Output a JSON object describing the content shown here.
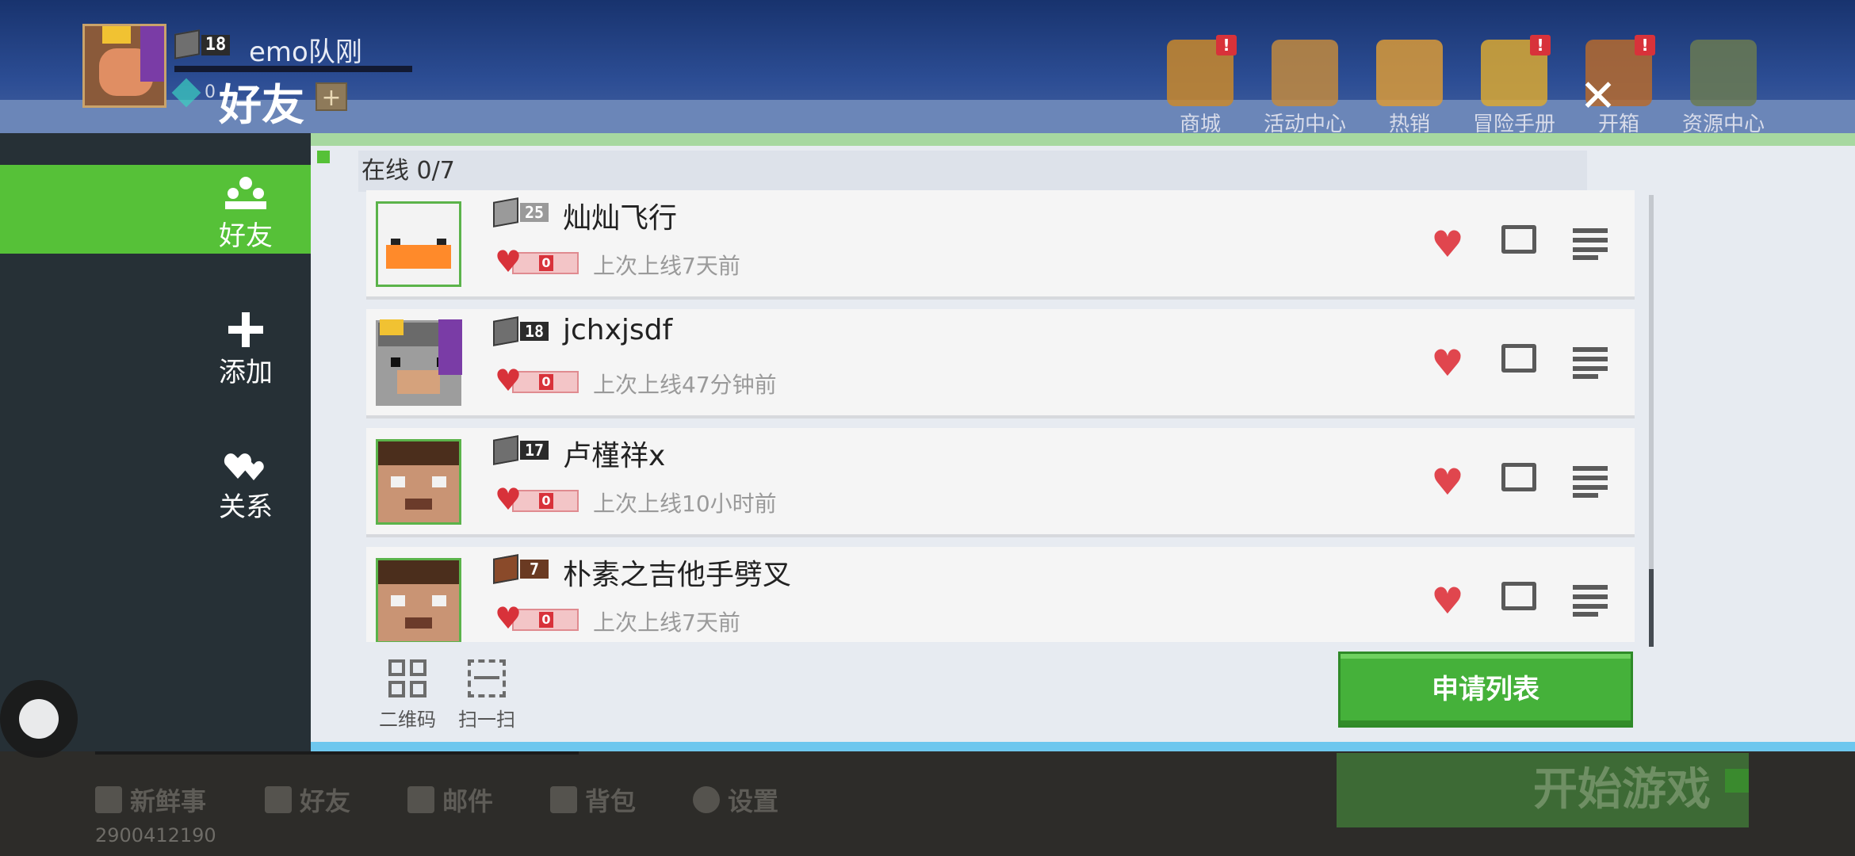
{
  "header": {
    "username": "emo队刚",
    "level": "18",
    "gem_value": "0",
    "page_title": "好友",
    "top_icons": [
      {
        "label": "商城",
        "icon": "shop-icon",
        "alert": "!",
        "color": "#c9882c"
      },
      {
        "label": "活动中心",
        "icon": "activity-center-icon",
        "alert": "",
        "color": "#c28a3e"
      },
      {
        "label": "热销",
        "icon": "hot-sale-icon",
        "alert": "",
        "color": "#d99a38"
      },
      {
        "label": "冒险手册",
        "icon": "adventure-handbook-icon",
        "alert": "!",
        "color": "#d9a832"
      },
      {
        "label": "开箱",
        "icon": "open-box-icon",
        "alert": "!",
        "color": "#b56a2e"
      },
      {
        "label": "资源中心",
        "icon": "resource-center-icon",
        "alert": "",
        "color": "#6a7a52"
      }
    ]
  },
  "sidebar": {
    "items": [
      {
        "label": "好友",
        "icon": "friends-icon",
        "active": true
      },
      {
        "label": "添加",
        "icon": "add-icon",
        "active": false
      },
      {
        "label": "关系",
        "icon": "relationship-icon",
        "active": false
      }
    ]
  },
  "main": {
    "online": "在线 0/7",
    "friends": [
      {
        "name": "灿灿飞行",
        "level": "25",
        "last_seen": "上次上线7天前",
        "hearts": "0",
        "skin": "chicken"
      },
      {
        "name": "jchxjsdf",
        "level": "18",
        "last_seen": "上次上线47分钟前",
        "hearts": "0",
        "skin": "wolf"
      },
      {
        "name": "卢槿祥x",
        "level": "17",
        "last_seen": "上次上线10小时前",
        "hearts": "0",
        "skin": "steve"
      },
      {
        "name": "朴素之吉他手劈叉",
        "level": "7",
        "last_seen": "上次上线7天前",
        "hearts": "0",
        "skin": "steve"
      }
    ],
    "qr_label": "二维码",
    "scan_label": "扫一扫",
    "apply_list": "申请列表"
  },
  "bottom": {
    "nav": [
      "新鲜事",
      "好友",
      "邮件",
      "背包",
      "设置"
    ],
    "user_id": "2900412190",
    "start_game": "开始游戏"
  },
  "colors": {
    "accent_green": "#56c138",
    "heart_red": "#d8323a"
  }
}
